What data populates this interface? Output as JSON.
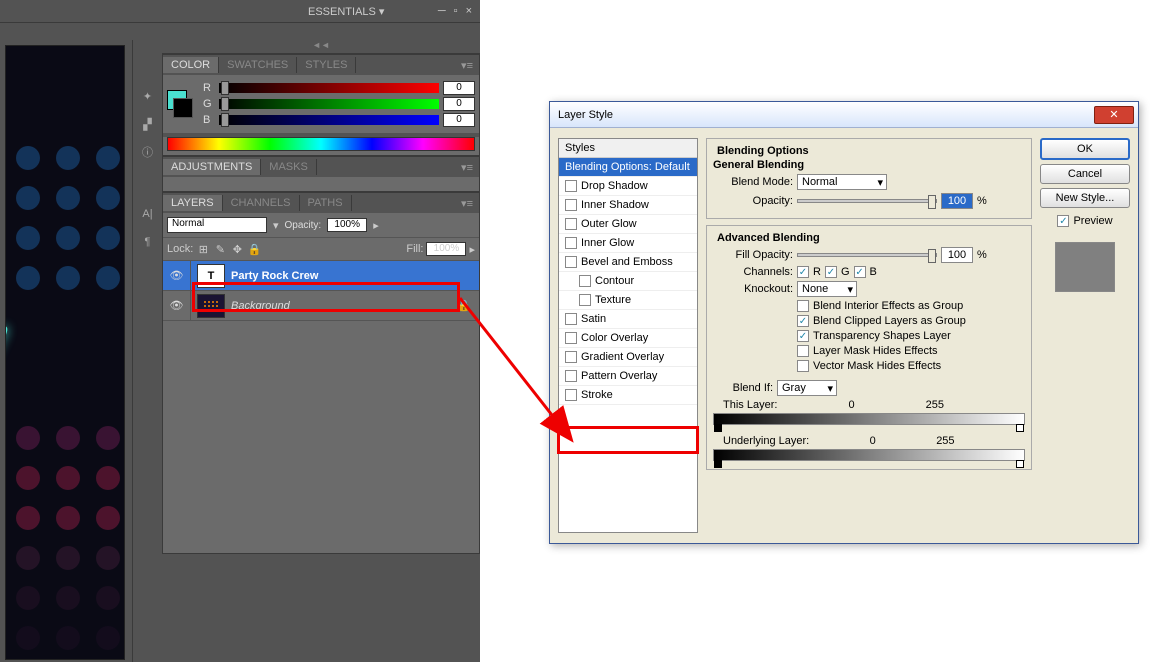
{
  "titlebar": {
    "workspace": "ESSENTIALS ▾"
  },
  "color_panel": {
    "tabs": [
      "COLOR",
      "SWATCHES",
      "STYLES"
    ],
    "active_tab": "COLOR",
    "rgb": {
      "r_label": "R",
      "g_label": "G",
      "b_label": "B",
      "r": "0",
      "g": "0",
      "b": "0"
    }
  },
  "adjustments_panel": {
    "tabs": [
      "ADJUSTMENTS",
      "MASKS"
    ],
    "active_tab": "ADJUSTMENTS"
  },
  "layers_panel": {
    "tabs": [
      "LAYERS",
      "CHANNELS",
      "PATHS"
    ],
    "active_tab": "LAYERS",
    "blend_mode": "Normal",
    "opacity_label": "Opacity:",
    "opacity": "100%",
    "lock_label": "Lock:",
    "fill_label": "Fill:",
    "fill": "100%",
    "layers": [
      {
        "thumb": "T",
        "name": "Party Rock Crew",
        "selected": true
      },
      {
        "thumb": "bg",
        "name": "Background",
        "locked": true
      }
    ]
  },
  "dialog": {
    "title": "Layer Style",
    "styles_header": "Styles",
    "styles": [
      {
        "label": "Blending Options: Default",
        "selected": true,
        "no_chk": true
      },
      {
        "label": "Drop Shadow"
      },
      {
        "label": "Inner Shadow"
      },
      {
        "label": "Outer Glow"
      },
      {
        "label": "Inner Glow"
      },
      {
        "label": "Bevel and Emboss"
      },
      {
        "label": "Contour",
        "sub": true
      },
      {
        "label": "Texture",
        "sub": true
      },
      {
        "label": "Satin"
      },
      {
        "label": "Color Overlay"
      },
      {
        "label": "Gradient Overlay"
      },
      {
        "label": "Pattern Overlay"
      },
      {
        "label": "Stroke",
        "highlight": true
      }
    ],
    "blending": {
      "section_title": "Blending Options",
      "general_title": "General Blending",
      "blend_mode_label": "Blend Mode:",
      "blend_mode": "Normal",
      "opacity_label": "Opacity:",
      "opacity": "100",
      "pct": "%",
      "advanced_title": "Advanced Blending",
      "fill_opacity_label": "Fill Opacity:",
      "fill_opacity": "100",
      "channels_label": "Channels:",
      "ch_r": "R",
      "ch_g": "G",
      "ch_b": "B",
      "knockout_label": "Knockout:",
      "knockout": "None",
      "opt1": "Blend Interior Effects as Group",
      "opt2": "Blend Clipped Layers as Group",
      "opt3": "Transparency Shapes Layer",
      "opt4": "Layer Mask Hides Effects",
      "opt5": "Vector Mask Hides Effects",
      "blend_if_label": "Blend If:",
      "blend_if": "Gray",
      "this_layer_label": "This Layer:",
      "this_min": "0",
      "this_max": "255",
      "under_layer_label": "Underlying Layer:",
      "under_min": "0",
      "under_max": "255"
    },
    "buttons": {
      "ok": "OK",
      "cancel": "Cancel",
      "new_style": "New Style...",
      "preview": "Preview"
    }
  }
}
